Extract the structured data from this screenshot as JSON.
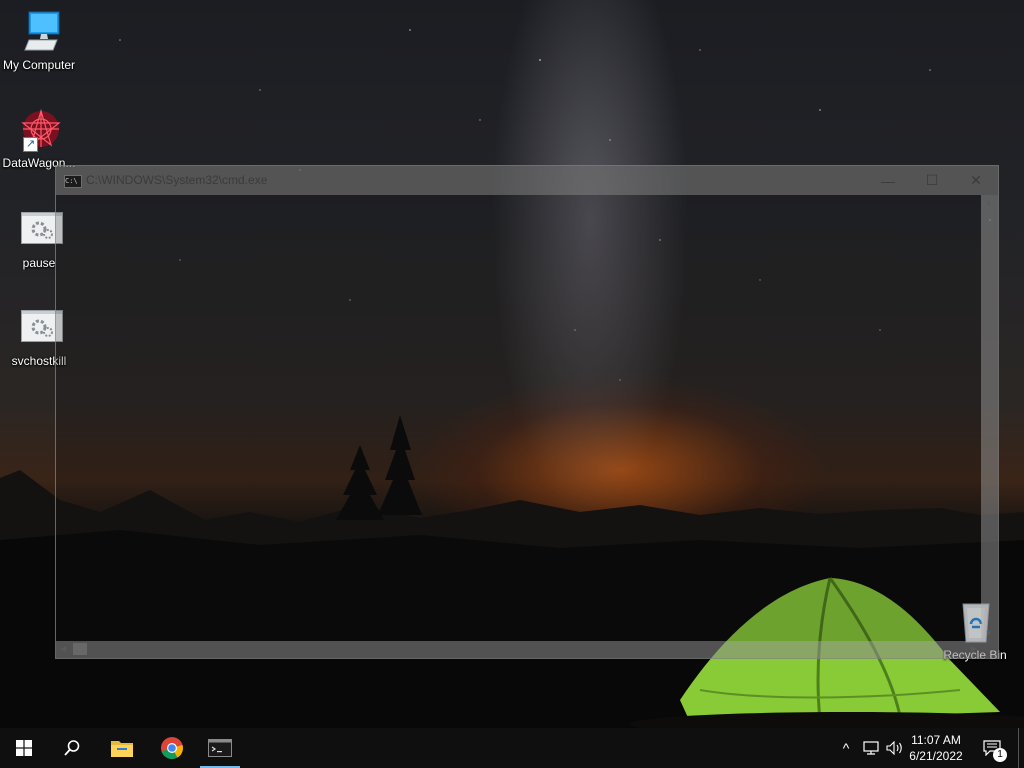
{
  "desktop": {
    "icons": [
      {
        "label": "My Computer",
        "icon": "computer-icon"
      },
      {
        "label": "DataWagon...",
        "icon": "datawagon-app-icon",
        "shortcut": true
      },
      {
        "label": "pause",
        "icon": "batch-file-icon"
      },
      {
        "label": "svchostkill",
        "icon": "batch-file-icon"
      },
      {
        "label": "Recycle Bin",
        "icon": "recycle-bin-icon"
      }
    ]
  },
  "cmd_window": {
    "title": "C:\\WINDOWS\\System32\\cmd.exe",
    "icon_text": "C:\\",
    "minimize_symbol": "—",
    "maximize_symbol": "☐",
    "close_symbol": "✕"
  },
  "taskbar": {
    "buttons": [
      {
        "name": "start",
        "icon": "windows-logo-icon"
      },
      {
        "name": "search",
        "icon": "search-icon"
      },
      {
        "name": "file-explorer",
        "icon": "folder-icon"
      },
      {
        "name": "chrome",
        "icon": "chrome-icon"
      },
      {
        "name": "cmd",
        "icon": "cmd-icon",
        "active": true
      }
    ],
    "tray": {
      "chevron": "^",
      "time": "11:07 AM",
      "date": "6/21/2022",
      "notification_count": "1"
    }
  },
  "colors": {
    "taskbar_bg": "#0f0f0f",
    "active_indicator": "#76b9ed",
    "tent_green": "#8fd63a"
  }
}
